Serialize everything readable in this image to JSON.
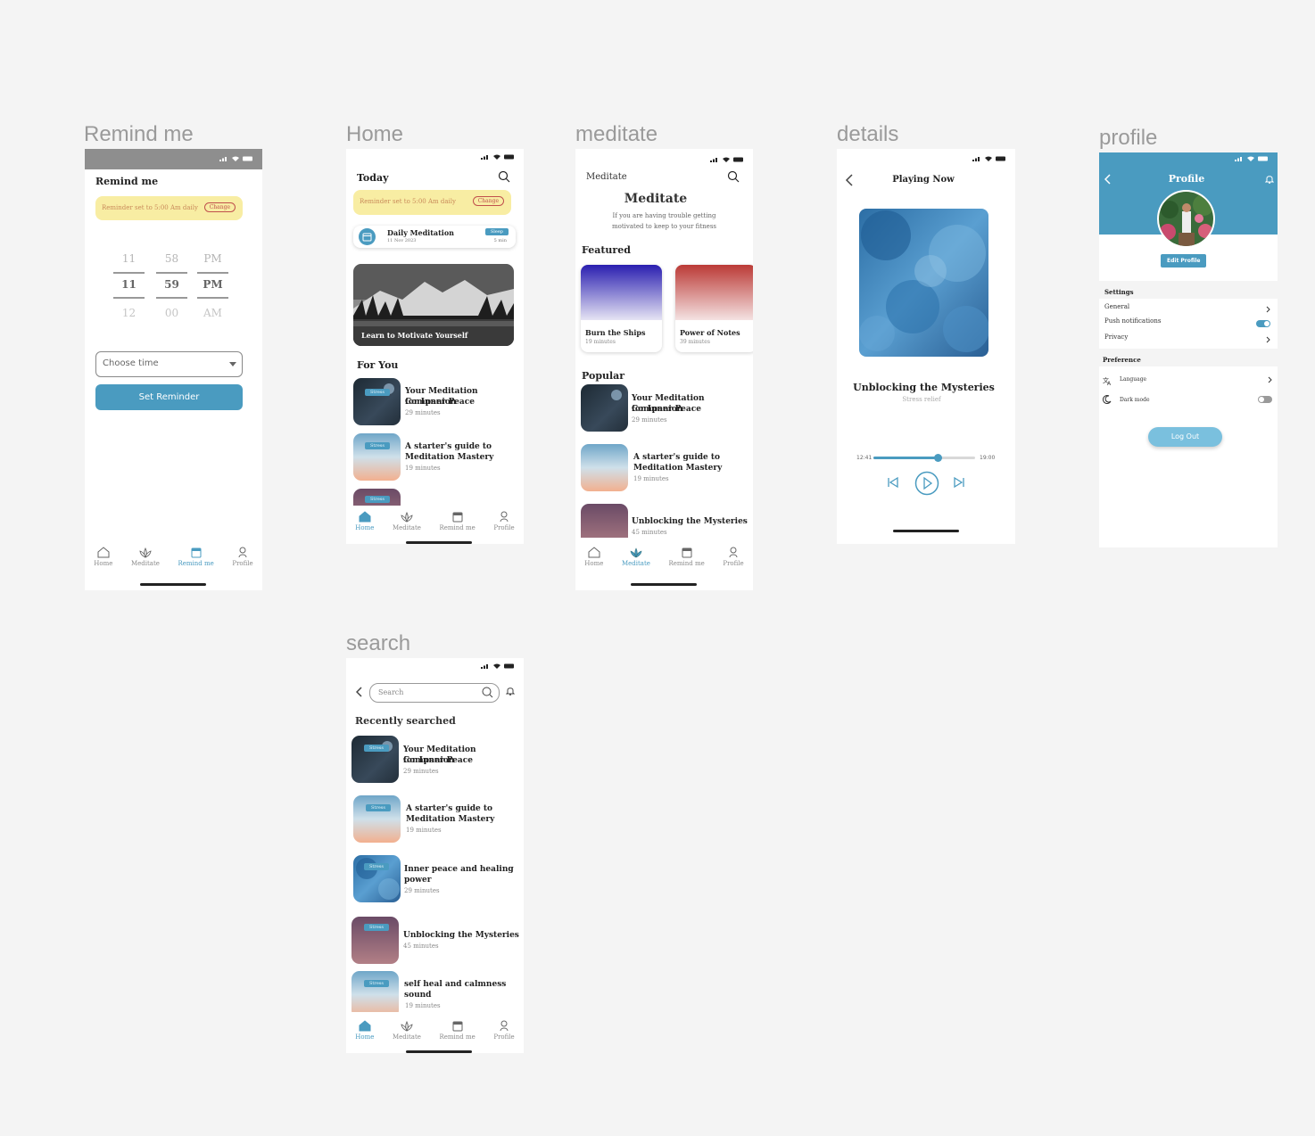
{
  "frames": {
    "remind": "Remind me",
    "home": "Home",
    "meditate": "meditate",
    "details": "details",
    "profile": "profile",
    "search": "search"
  },
  "nav": {
    "home": "Home",
    "meditate": "Meditate",
    "remind": "Remind me",
    "profile": "Profile"
  },
  "remind": {
    "title": "Remind me",
    "banner": "Reminder set to 5:00 Am daily",
    "change": "Change",
    "picker": {
      "hours": [
        "11",
        "11",
        "12"
      ],
      "minutes": [
        "58",
        "59",
        "00"
      ],
      "ampm": [
        "PM",
        "PM",
        "AM"
      ]
    },
    "select_placeholder": "Choose time",
    "button": "Set Reminder"
  },
  "home": {
    "title": "Today",
    "banner": "Reminder set to 5:00 Am daily",
    "change": "Change",
    "daily": {
      "title": "Daily Meditation",
      "date": "11 Nov 2023",
      "tag": "Sleep",
      "duration": "5 min"
    },
    "hero": "Learn to Motivate Yourself",
    "for_you": "For You",
    "items": [
      {
        "tag": "Stress",
        "title1": "Your Meditation Companion",
        "title2": "for Inner Peace",
        "sub": "29 minutes"
      },
      {
        "tag": "Stress",
        "title1": "A starter's guide to",
        "title2": "Meditation Mastery",
        "sub": "19 minutes"
      },
      {
        "tag": "Stress"
      }
    ]
  },
  "meditate": {
    "title": "Meditate",
    "heading": "Meditate",
    "desc1": "If you are having trouble getting",
    "desc2": "motivated to keep to your fitness",
    "featured": "Featured",
    "cards": [
      {
        "title": "Burn the Ships",
        "sub": "19 minutes"
      },
      {
        "title": "Power of Notes",
        "sub": "39 minutes"
      }
    ],
    "popular": "Popular",
    "items": [
      {
        "title1": "Your Meditation Companion",
        "title2": "for Inner Peace",
        "sub": "29 minutes"
      },
      {
        "title1": "A starter's guide to",
        "title2": "Meditation Mastery",
        "sub": "19 minutes"
      },
      {
        "title1": "Unblocking the Mysteries",
        "sub": "45 minutes"
      }
    ]
  },
  "details": {
    "header": "Playing Now",
    "title": "Unblocking the Mysteries",
    "subtitle": "Stress relief",
    "elapsed": "12:41",
    "total": "19:00",
    "progress": 0.63
  },
  "profile": {
    "title": "Profile",
    "edit": "Edit Profile",
    "settings": "Settings",
    "general": "General",
    "push": "Push notifications",
    "privacy": "Privacy",
    "preference": "Preference",
    "language": "Language",
    "dark": "Dark mode",
    "logout": "Log Out",
    "push_on": true,
    "dark_on": false
  },
  "search": {
    "placeholder": "Search",
    "recent": "Recently searched",
    "items": [
      {
        "tag": "Stress",
        "title1": "Your Meditation Companion",
        "title2": "for Inner Peace",
        "sub": "29 minutes"
      },
      {
        "tag": "Stress",
        "title1": "A starter's guide to",
        "title2": "Meditation Mastery",
        "sub": "19 minutes"
      },
      {
        "tag": "Stress",
        "title1": "Inner peace and healing",
        "title2": "power",
        "sub": "29 minutes"
      },
      {
        "tag": "Stress",
        "title1": "Unblocking the Mysteries",
        "sub": "45 minutes"
      },
      {
        "tag": "Stress",
        "title1": "self  heal and calmness",
        "title2": "sound",
        "sub": "19 minutes"
      }
    ]
  },
  "colors": {
    "accent": "#4a9bc0",
    "banner": "#f8eda3",
    "background": "#f4f4f4"
  }
}
